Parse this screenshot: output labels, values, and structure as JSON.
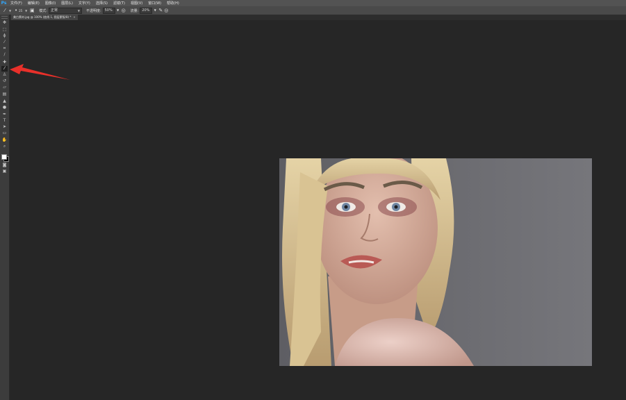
{
  "app": {
    "logo": "Ps"
  },
  "menu": [
    "文件(F)",
    "编辑(E)",
    "图像(I)",
    "图层(L)",
    "文字(Y)",
    "选择(S)",
    "滤镜(T)",
    "视图(V)",
    "窗口(W)",
    "帮助(H)"
  ],
  "options": {
    "size": "25",
    "mode_label": "模式:",
    "mode_value": "正常",
    "opacity_label": "不透明度:",
    "opacity_value": "50%",
    "flow_label": "流量:",
    "flow_value": "20%"
  },
  "document": {
    "tab_label": "美白素材.jpg @ 100% (曲线 1, 图层蒙版/8) *",
    "close_glyph": "×"
  },
  "colors": {
    "accent": "#31a8ff",
    "annotation": "#e8302a",
    "canvas_bg": "#262626"
  },
  "tool_icons": [
    "move-icon",
    "marquee-icon",
    "lasso-icon",
    "quick-select-icon",
    "crop-icon",
    "eyedropper-icon",
    "healing-icon",
    "brush-icon",
    "clone-stamp-icon",
    "history-brush-icon",
    "eraser-icon",
    "gradient-icon",
    "blur-icon",
    "dodge-icon",
    "pen-icon",
    "type-icon",
    "path-select-icon",
    "shape-icon",
    "hand-icon",
    "zoom-icon"
  ]
}
